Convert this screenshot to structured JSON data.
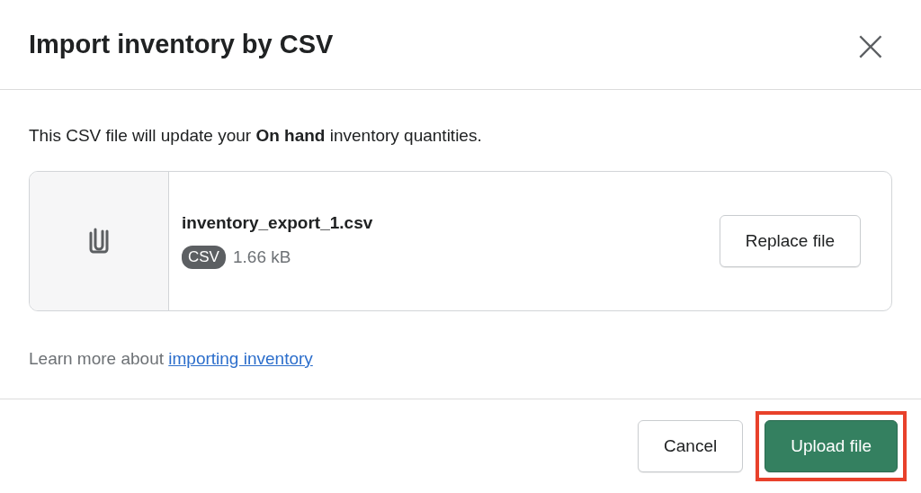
{
  "dialog": {
    "title": "Import inventory by CSV",
    "close": "×"
  },
  "body": {
    "description": "This CSV file will update your **On hand** inventory quantities.",
    "file": {
      "name": "inventory_export_1.csv",
      "type_badge": "CSV",
      "size": "1.66 kB",
      "action": "Replace file"
    },
    "help": {
      "text": "Learn more about",
      "link": "importing inventory"
    }
  },
  "footer": {
    "buttons": [
      {
        "label": "Cancel",
        "kind": "secondary",
        "highlighted": false
      },
      {
        "label": "Upload file",
        "kind": "primary",
        "highlighted": true
      }
    ]
  }
}
